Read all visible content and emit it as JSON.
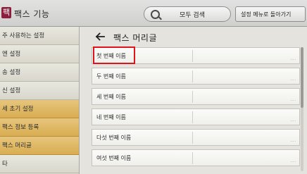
{
  "header": {
    "logo_glyph": "팩",
    "title": "팩스 기능",
    "search_label": "모두 검색",
    "settings_menu_label": "설정 메뉴로 돌아가기"
  },
  "sidebar": {
    "items": [
      {
        "label": "주 사용하는 설정",
        "active": false
      },
      {
        "label": "엔 설정",
        "active": false
      },
      {
        "label": "송 설정",
        "active": false
      },
      {
        "label": "신 설정",
        "active": false
      },
      {
        "label": "세 초기 설정",
        "active": true
      },
      {
        "label": "팩스 정보 등록",
        "active": true
      },
      {
        "label": "팩스 머리글",
        "active": true
      },
      {
        "label": "타",
        "active": false
      }
    ]
  },
  "main": {
    "title": "팩스 머리글",
    "items": [
      {
        "label": "첫 번째 이름",
        "selected": true
      },
      {
        "label": "두 번째 이름",
        "selected": false
      },
      {
        "label": "세 번째 이름",
        "selected": false
      },
      {
        "label": "네 번째 이름",
        "selected": false
      },
      {
        "label": "다섯 번째 이름",
        "selected": false
      },
      {
        "label": "여섯 번째 이름",
        "selected": false
      }
    ]
  },
  "colors": {
    "highlight": "#e0121a",
    "active_sidebar": "#d9ad52",
    "logo": "#8b1d3d"
  },
  "icons": {
    "back": "back-arrow-icon",
    "search": "search-icon"
  }
}
